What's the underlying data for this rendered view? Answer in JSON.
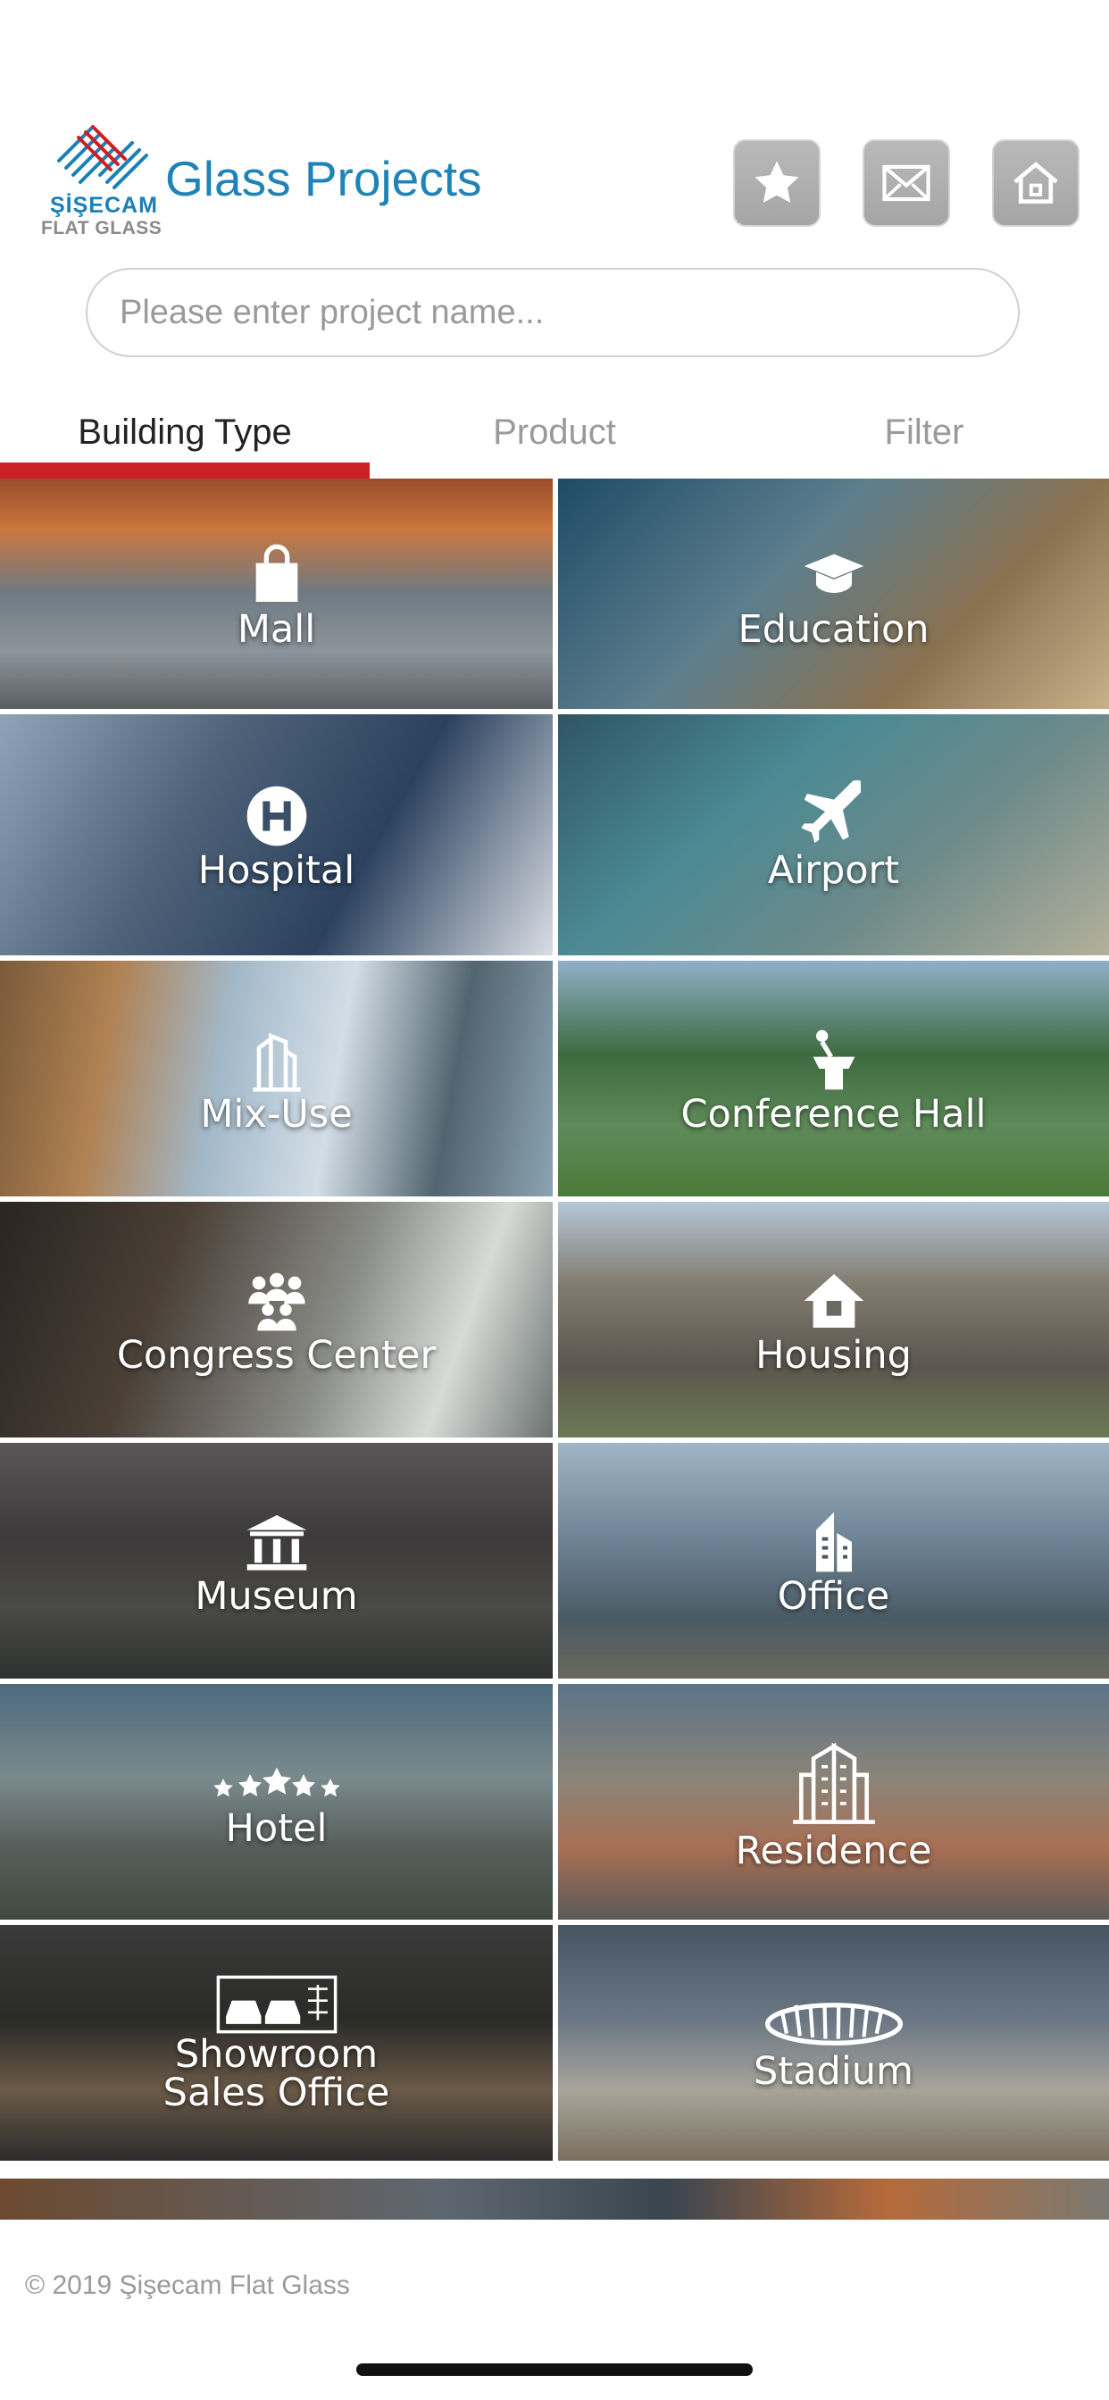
{
  "header": {
    "logo_brand": "ŞİŞECAM",
    "logo_sub": "FLAT GLASS",
    "title": "Glass Projects",
    "buttons": [
      "star-icon",
      "mail-icon",
      "home-icon"
    ]
  },
  "search": {
    "placeholder": "Please enter project name...",
    "value": ""
  },
  "tabs": [
    {
      "label": "Building Type",
      "active": true
    },
    {
      "label": "Product",
      "active": false
    },
    {
      "label": "Filter",
      "active": false
    }
  ],
  "categories": [
    {
      "label": "Mall",
      "icon": "shopping-bag-icon"
    },
    {
      "label": "Education",
      "icon": "graduation-cap-icon"
    },
    {
      "label": "Hospital",
      "icon": "hospital-h-icon"
    },
    {
      "label": "Airport",
      "icon": "airplane-icon"
    },
    {
      "label": "Mix-Use",
      "icon": "tower-icon"
    },
    {
      "label": "Conference Hall",
      "icon": "lectern-icon"
    },
    {
      "label": "Congress Center",
      "icon": "people-icon"
    },
    {
      "label": "Housing",
      "icon": "house-icon"
    },
    {
      "label": "Museum",
      "icon": "museum-icon"
    },
    {
      "label": "Office",
      "icon": "office-building-icon"
    },
    {
      "label": "Hotel",
      "icon": "stars-icon"
    },
    {
      "label": "Residence",
      "icon": "residence-towers-icon"
    },
    {
      "label": "Showroom\nSales Office",
      "icon": "cars-icon"
    },
    {
      "label": "Stadium",
      "icon": "stadium-icon"
    }
  ],
  "footer": {
    "copyright": "© 2019 Şişecam Flat Glass"
  },
  "colors": {
    "brand_blue": "#1e84b8",
    "tab_indicator": "#cc1f26",
    "button_gray": "#a9a9a9"
  }
}
